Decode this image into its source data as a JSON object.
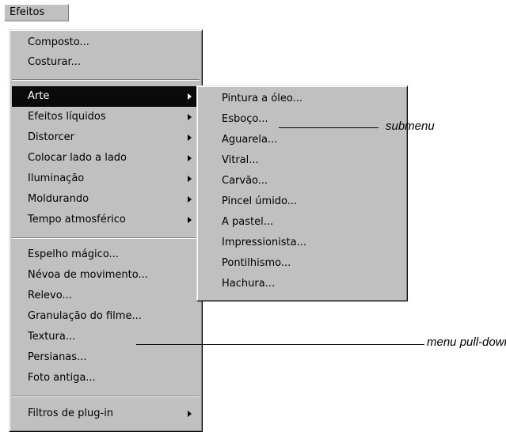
{
  "menubar": {
    "title": "Efeitos"
  },
  "menu": {
    "group1": [
      "Composto...",
      "Costurar..."
    ],
    "group2": [
      {
        "label": "Arte",
        "submenu": true,
        "selected": true
      },
      {
        "label": "Efeitos líquidos",
        "submenu": true
      },
      {
        "label": "Distorcer",
        "submenu": true
      },
      {
        "label": "Colocar lado a lado",
        "submenu": true
      },
      {
        "label": "Iluminação",
        "submenu": true
      },
      {
        "label": "Moldurando",
        "submenu": true
      },
      {
        "label": "Tempo atmosférico",
        "submenu": true
      }
    ],
    "group3": [
      "Espelho mágico...",
      "Névoa de movimento...",
      "Relevo...",
      "Granulação do filme...",
      "Textura...",
      "Persianas...",
      "Foto antiga..."
    ],
    "group4": [
      {
        "label": "Filtros de plug-in",
        "submenu": true
      }
    ]
  },
  "submenu": {
    "items": [
      "Pintura a óleo...",
      "Esboço...",
      "Aguarela...",
      "Vitral...",
      "Carvão...",
      "Pincel úmido...",
      "A pastel...",
      "Impressionista...",
      "Pontilhismo...",
      "Hachura..."
    ]
  },
  "annotations": {
    "submenu": "submenu",
    "pulldown": "menu pull-down"
  },
  "colors": {
    "menu_bg": "#c0c0c0",
    "selection_bg": "#0a0a0a",
    "selection_text": "#ffffff"
  }
}
